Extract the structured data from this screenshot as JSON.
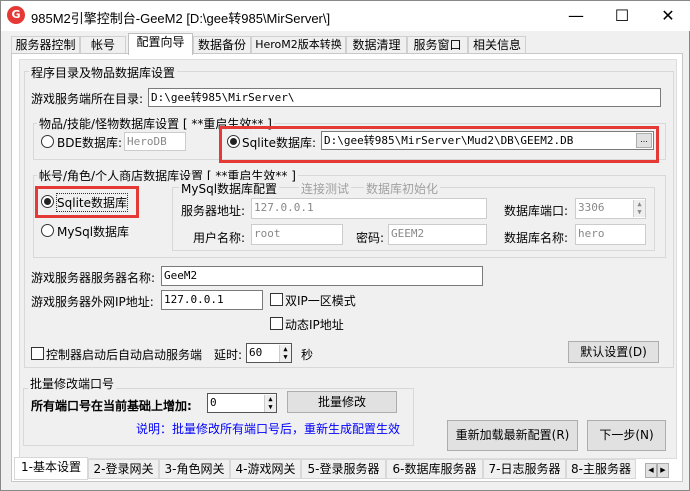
{
  "window": {
    "title": "985M2引擎控制台-GeeM2 [D:\\gee转985\\MirServer\\]",
    "minimize": "—",
    "maximize": "☐",
    "close": "✕"
  },
  "tabs": [
    "服务器控制",
    "帐号",
    "配置向导",
    "数据备份",
    "HeroM2版本转换",
    "数据清理",
    "服务窗口",
    "相关信息"
  ],
  "group_main": {
    "label": "程序目录及物品数据库设置",
    "dir_label": "游戏服务端所在目录:",
    "dir_value": "D:\\gee转985\\MirServer\\"
  },
  "group_items": {
    "label": "物品/技能/怪物数据库设置 [ **重启生效** ]",
    "bde_label": "BDE数据库:",
    "bde_value": "HeroDB",
    "sqlite_label": "Sqlite数据库:",
    "sqlite_value": "D:\\gee转985\\MirServer\\Mud2\\DB\\GEEM2.DB",
    "browse": "...",
    "selected": "sqlite"
  },
  "group_account": {
    "label": "帐号/角色/个人商店数据库设置 [ **重启生效** ]",
    "sqlite_label": "Sqlite数据库",
    "mysql_label": "MySql数据库",
    "selected": "sqlite",
    "mysql": {
      "label": "MySql数据库配置",
      "test": "连接测试",
      "init": "数据库初始化",
      "host_label": "服务器地址:",
      "host": "127.0.0.1",
      "port_label": "数据库端口:",
      "port": "3306",
      "user_label": "用户名称:",
      "user": "root",
      "pwd_label": "密码:",
      "pwd": "GEEM2",
      "db_label": "数据库名称:",
      "db": "hero"
    }
  },
  "server_name_label": "游戏服务器服务器名称:",
  "server_name": "GeeM2",
  "ip_label": "游戏服务器外网IP地址:",
  "ip": "127.0.0.1",
  "dual_ip": {
    "label": "双IP一区模式",
    "checked": false
  },
  "dynamic_ip": {
    "label": "动态IP地址",
    "checked": false
  },
  "autostart": {
    "label": "控制器启动后自动启动服务端",
    "checked": false,
    "delay_label": "延时:",
    "delay": "60",
    "unit": "秒"
  },
  "default_button": "默认设置(D)",
  "batch": {
    "label": "批量修改端口号",
    "inc_label": "所有端口号在当前基础上增加:",
    "inc": "0",
    "button": "批量修改",
    "note": "说明：批量修改所有端口号后，重新生成配置生效",
    "note_color": "#0000ff"
  },
  "reload_button": "重新加载最新配置(R)",
  "next_button": "下一步(N)",
  "bottom_tabs": [
    "1-基本设置",
    "2-登录网关",
    "3-角色网关",
    "4-游戏网关",
    "5-登录服务器",
    "6-数据库服务器",
    "7-日志服务器",
    "8-主服务器"
  ],
  "highlight_color": "#e53935"
}
